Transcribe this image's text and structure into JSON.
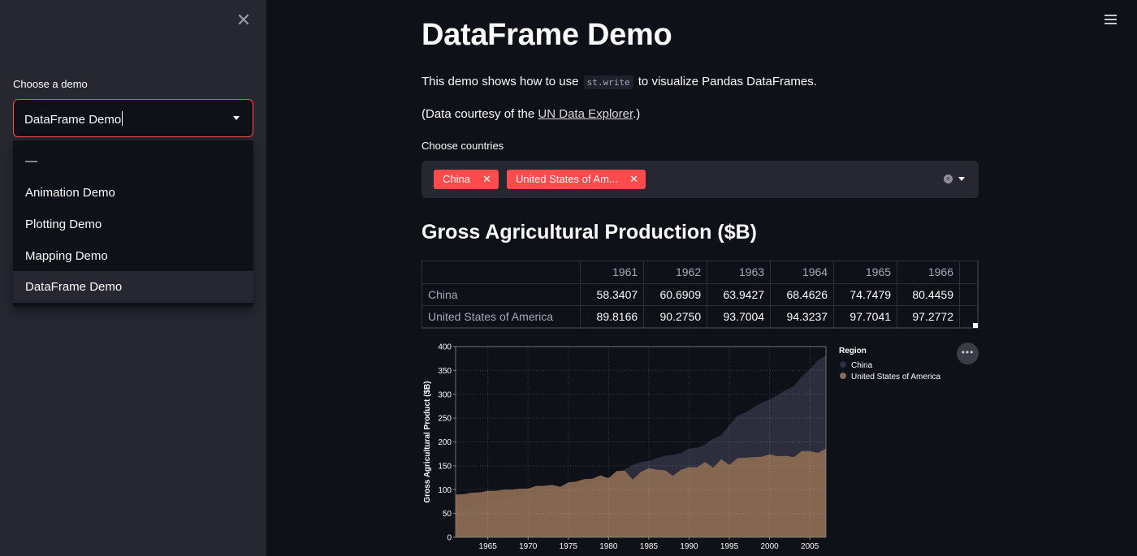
{
  "sidebar": {
    "close_symbol": "✕",
    "select_label": "Choose a demo",
    "selected_value": "DataFrame Demo",
    "options": [
      "—",
      "Animation Demo",
      "Plotting Demo",
      "Mapping Demo",
      "DataFrame Demo"
    ]
  },
  "main": {
    "title": "DataFrame Demo",
    "intro_before": "This demo shows how to use",
    "intro_code": "st.write",
    "intro_after": "to visualize Pandas DataFrames.",
    "courtesy_before": "(Data courtesy of the",
    "courtesy_link": "UN Data Explorer",
    "courtesy_after": ".)",
    "countries_label": "Choose countries",
    "selected_countries": [
      "China",
      "United States of Am..."
    ],
    "tag_remove_symbol": "✕",
    "clear_symbol": "×",
    "section_title": "Gross Agricultural Production ($B)"
  },
  "table": {
    "columns": [
      "1961",
      "1962",
      "1963",
      "1964",
      "1965",
      "1966"
    ],
    "rows": [
      {
        "label": "China",
        "values": [
          "58.3407",
          "60.6909",
          "63.9427",
          "68.4626",
          "74.7479",
          "80.4459"
        ]
      },
      {
        "label": "United States of America",
        "values": [
          "89.8166",
          "90.2750",
          "93.7004",
          "94.3237",
          "97.7041",
          "97.2772"
        ]
      }
    ]
  },
  "chart_menu_symbol": "•••",
  "chart_data": {
    "type": "area",
    "title": "",
    "xlabel": "",
    "ylabel": "Gross Agricultural Product ($B)",
    "xlim": [
      1961,
      2007
    ],
    "ylim": [
      0,
      400
    ],
    "x_ticks": [
      1965,
      1970,
      1975,
      1980,
      1985,
      1990,
      1995,
      2000,
      2005
    ],
    "y_ticks": [
      0,
      50,
      100,
      150,
      200,
      250,
      300,
      350,
      400
    ],
    "grid": true,
    "legend_title": "Region",
    "legend_position": "top-right",
    "x": [
      1961,
      1962,
      1963,
      1964,
      1965,
      1966,
      1967,
      1968,
      1969,
      1970,
      1971,
      1972,
      1973,
      1974,
      1975,
      1976,
      1977,
      1978,
      1979,
      1980,
      1981,
      1982,
      1983,
      1984,
      1985,
      1986,
      1987,
      1988,
      1989,
      1990,
      1991,
      1992,
      1993,
      1994,
      1995,
      1996,
      1997,
      1998,
      1999,
      2000,
      2001,
      2002,
      2003,
      2004,
      2005,
      2006,
      2007
    ],
    "series": [
      {
        "name": "China",
        "color": "#2e3040",
        "values": [
          58.3,
          60.7,
          63.9,
          68.5,
          74.7,
          80.4,
          82,
          83,
          84,
          89,
          92,
          91,
          97,
          100,
          103,
          104,
          104,
          111,
          121,
          126,
          132,
          142,
          152,
          158,
          160,
          166,
          171,
          173,
          177,
          186,
          188,
          195,
          207,
          214,
          235,
          255,
          262,
          272,
          282,
          289,
          298,
          309,
          317,
          337,
          352,
          371,
          382
        ]
      },
      {
        "name": "United States of America",
        "color": "#8a6a52",
        "values": [
          89.8,
          90.3,
          93.7,
          94.3,
          97.7,
          97.3,
          100,
          100,
          102,
          102,
          108,
          108,
          110,
          106,
          115,
          117,
          122,
          123,
          130,
          124,
          139,
          140,
          121,
          137,
          145,
          142,
          141,
          129,
          142,
          147,
          147,
          158,
          146,
          164,
          152,
          166,
          167,
          168,
          169,
          174,
          170,
          171,
          168,
          181,
          181,
          177,
          186
        ]
      }
    ]
  }
}
